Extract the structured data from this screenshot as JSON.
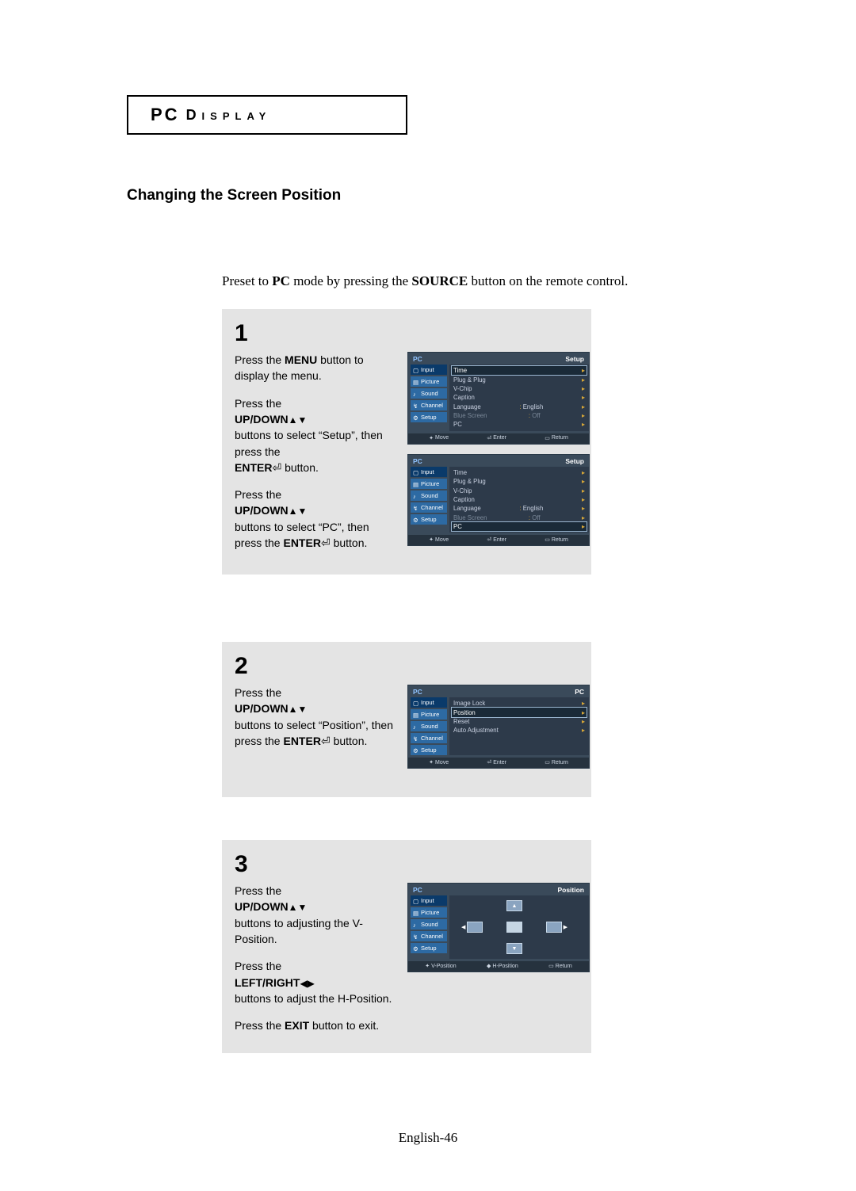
{
  "header": {
    "title_pc": "PC",
    "title_display": "Display"
  },
  "section_heading": "Changing the Screen Position",
  "preset": {
    "pre": "Preset to ",
    "pc": "PC",
    "mid": " mode by pressing the ",
    "source": "SOURCE",
    "post": " button on the remote control."
  },
  "labels": {
    "menu": "MENU",
    "updown": "UP/DOWN",
    "leftright": "LEFT/RIGHT",
    "enter": "ENTER",
    "exit": "EXIT",
    "button": "button",
    "buttons": "buttons"
  },
  "step1": {
    "num": "1",
    "p1a": "Press the ",
    "p1b": " button to display the menu.",
    "p2a": "Press the ",
    "p2b": " buttons to select “Setup”, then press the ",
    "p2c": " button.",
    "p3a": "Press the ",
    "p3b": " buttons to select “PC”, then press the ",
    "p3c": " button."
  },
  "step2": {
    "num": "2",
    "p1a": "Press the ",
    "p1b": " buttons to select “Position”, then press the ",
    "p1c": " button."
  },
  "step3": {
    "num": "3",
    "p1a": "Press the ",
    "p1b": " buttons to adjusting the V-Position.",
    "p2a": "Press the ",
    "p2b": " buttons to adjust the H-Position.",
    "p3a": "Press the ",
    "p3b": " button to exit."
  },
  "osd": {
    "pc": "PC",
    "setup": "Setup",
    "pc_sub": "PC",
    "position_title": "Position",
    "sidebar": [
      "Input",
      "Picture",
      "Sound",
      "Channel",
      "Setup"
    ],
    "setup_menu": [
      {
        "label": "Time",
        "hl": true
      },
      {
        "label": "Plug & Plug"
      },
      {
        "label": "V-Chip"
      },
      {
        "label": "Caption"
      },
      {
        "label": "Language",
        "value": "English"
      },
      {
        "label": "Blue Screen",
        "value": "Off",
        "dim": true
      },
      {
        "label": "PC"
      }
    ],
    "setup_menu_pc_hl": [
      {
        "label": "Time"
      },
      {
        "label": "Plug & Plug"
      },
      {
        "label": "V-Chip"
      },
      {
        "label": "Caption"
      },
      {
        "label": "Language",
        "value": "English"
      },
      {
        "label": "Blue Screen",
        "value": "Off",
        "dim": true
      },
      {
        "label": "PC",
        "hl": true
      }
    ],
    "pc_menu": [
      {
        "label": "Image Lock"
      },
      {
        "label": "Position",
        "hl": true
      },
      {
        "label": "Reset"
      },
      {
        "label": "Auto Adjustment"
      }
    ],
    "foot_move": "Move",
    "foot_enter": "Enter",
    "foot_return": "Return",
    "foot_vpos": "V-Position",
    "foot_hpos": "H-Position"
  },
  "footer": {
    "lang": "English-",
    "pagenum": "46"
  }
}
